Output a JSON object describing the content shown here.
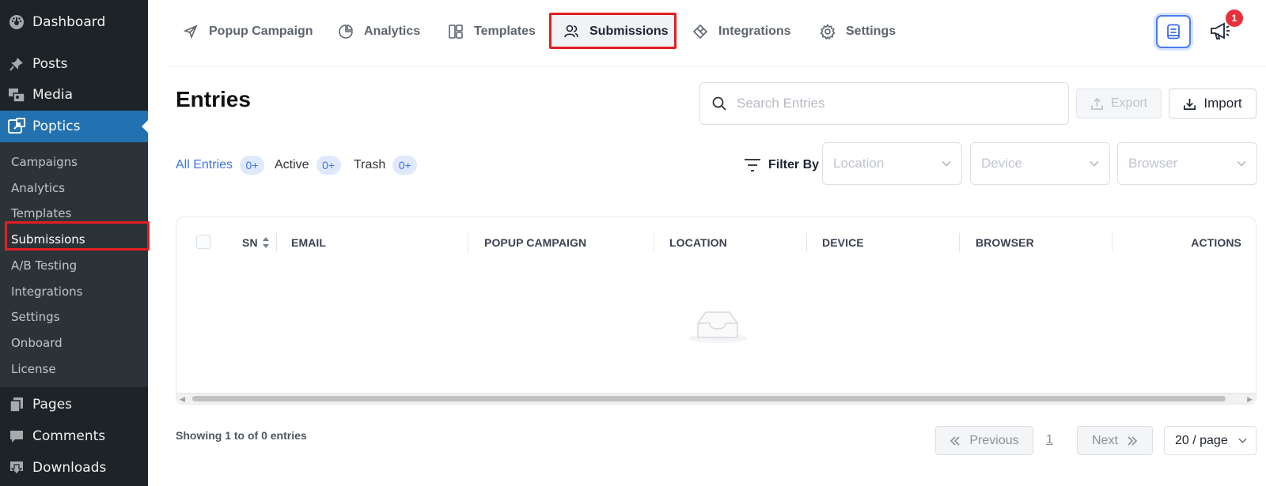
{
  "sidebar": {
    "top_items": [
      {
        "label": "Dashboard",
        "icon": "dashboard-icon"
      },
      {
        "label": "Posts",
        "icon": "pin-icon"
      },
      {
        "label": "Media",
        "icon": "media-icon"
      },
      {
        "label": "Poptics",
        "icon": "poptics-icon",
        "active": true
      }
    ],
    "submenu": [
      "Campaigns",
      "Analytics",
      "Templates",
      "Submissions",
      "A/B Testing",
      "Integrations",
      "Settings",
      "Onboard",
      "License"
    ],
    "bottom_items": [
      {
        "label": "Pages",
        "icon": "pages-icon"
      },
      {
        "label": "Comments",
        "icon": "comment-icon"
      },
      {
        "label": "Downloads",
        "icon": "download-icon"
      }
    ]
  },
  "topnav": {
    "tabs": [
      {
        "label": "Popup Campaign",
        "icon": "send-icon"
      },
      {
        "label": "Analytics",
        "icon": "pie-chart-icon"
      },
      {
        "label": "Templates",
        "icon": "layout-icon"
      },
      {
        "label": "Submissions",
        "icon": "users-icon",
        "selected": true
      },
      {
        "label": "Integrations",
        "icon": "integrations-icon"
      },
      {
        "label": "Settings",
        "icon": "gear-icon"
      }
    ],
    "notification_count": "1"
  },
  "page": {
    "title": "Entries",
    "search_placeholder": "Search Entries",
    "export_label": "Export",
    "import_label": "Import"
  },
  "filters": {
    "statuses": [
      {
        "label": "All Entries",
        "count": "0+"
      },
      {
        "label": "Active",
        "count": "0+"
      },
      {
        "label": "Trash",
        "count": "0+"
      }
    ],
    "filter_by_label": "Filter By",
    "selects": [
      "Location",
      "Device",
      "Browser"
    ]
  },
  "table": {
    "columns": [
      "SN",
      "EMAIL",
      "POPUP CAMPAIGN",
      "LOCATION",
      "DEVICE",
      "BROWSER",
      "ACTIONS"
    ],
    "rows": []
  },
  "footer": {
    "showing": "Showing 1 to of 0 entries",
    "previous_label": "Previous",
    "current_page": "1",
    "next_label": "Next",
    "per_page": "20 / page"
  },
  "colors": {
    "sidebar_bg": "#1d2327",
    "sidebar_active": "#2271b1",
    "accent": "#3a73e8",
    "highlight": "#e01f24"
  }
}
